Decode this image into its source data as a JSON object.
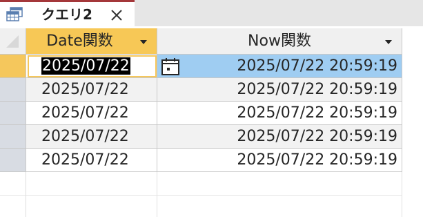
{
  "tab": {
    "title": "クエリ2",
    "icon": "query-icon",
    "close_icon": "close-icon"
  },
  "grid": {
    "columns": [
      {
        "label": "Date関数"
      },
      {
        "label": "Now関数"
      }
    ],
    "rows": [
      {
        "date": "2025/07/22",
        "now": "2025/07/22 20:59:19"
      },
      {
        "date": "2025/07/22",
        "now": "2025/07/22 20:59:19"
      },
      {
        "date": "2025/07/22",
        "now": "2025/07/22 20:59:19"
      },
      {
        "date": "2025/07/22",
        "now": "2025/07/22 20:59:19"
      },
      {
        "date": "2025/07/22",
        "now": "2025/07/22 20:59:19"
      }
    ],
    "date_picker_icon": "calendar-icon"
  },
  "colors": {
    "active_tab_accent": "#a4373a",
    "selected_header": "#f7c856",
    "selected_cell": "#9fcdf2"
  }
}
